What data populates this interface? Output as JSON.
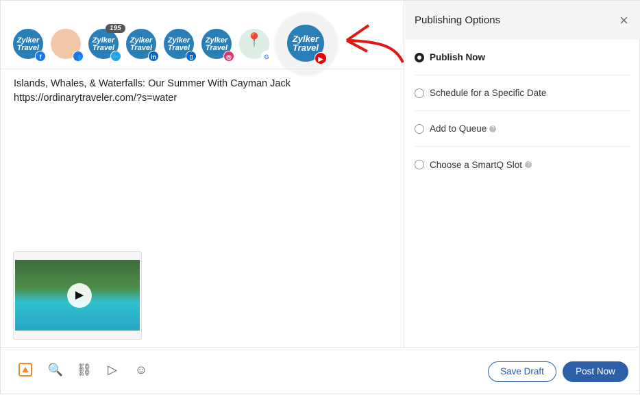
{
  "accounts": [
    {
      "label": "Zylker Travel",
      "network": "facebook",
      "badge": "f",
      "color": "#1877f2"
    },
    {
      "label": "",
      "network": "facebook-group",
      "badge": "👥",
      "color": "#1877f2"
    },
    {
      "label": "Zylker Travel",
      "network": "twitter",
      "badge": "🐦",
      "color": "#1da1f2",
      "count": "195"
    },
    {
      "label": "Zylker Travel",
      "network": "linkedin",
      "badge": "in",
      "color": "#0a66c2"
    },
    {
      "label": "Zylker Travel",
      "network": "linkedin-page",
      "badge": "▯",
      "color": "#0a66c2"
    },
    {
      "label": "Zylker Travel",
      "network": "instagram",
      "badge": "◎",
      "color": "#e1306c"
    },
    {
      "label": "",
      "network": "google-business",
      "badge": "G",
      "color": "#4285f4"
    },
    {
      "label": "Zylker Travel",
      "network": "youtube",
      "badge": "▶",
      "color": "#e00",
      "selected": true
    }
  ],
  "post": {
    "line1": "Islands, Whales, & Waterfalls: Our Summer With Cayman Jack",
    "line2": "https://ordinarytraveler.com/?s=water"
  },
  "panel": {
    "title": "Publishing Options",
    "close": "×",
    "options": [
      {
        "label": "Publish Now",
        "selected": true
      },
      {
        "label": "Schedule for a Specific Date"
      },
      {
        "label": "Add to Queue",
        "help": "?"
      },
      {
        "label": "Choose a SmartQ Slot",
        "help": "?"
      }
    ]
  },
  "toolbar": {
    "save_draft": "Save Draft",
    "post_now": "Post Now",
    "accent": "#2d5fa8"
  }
}
